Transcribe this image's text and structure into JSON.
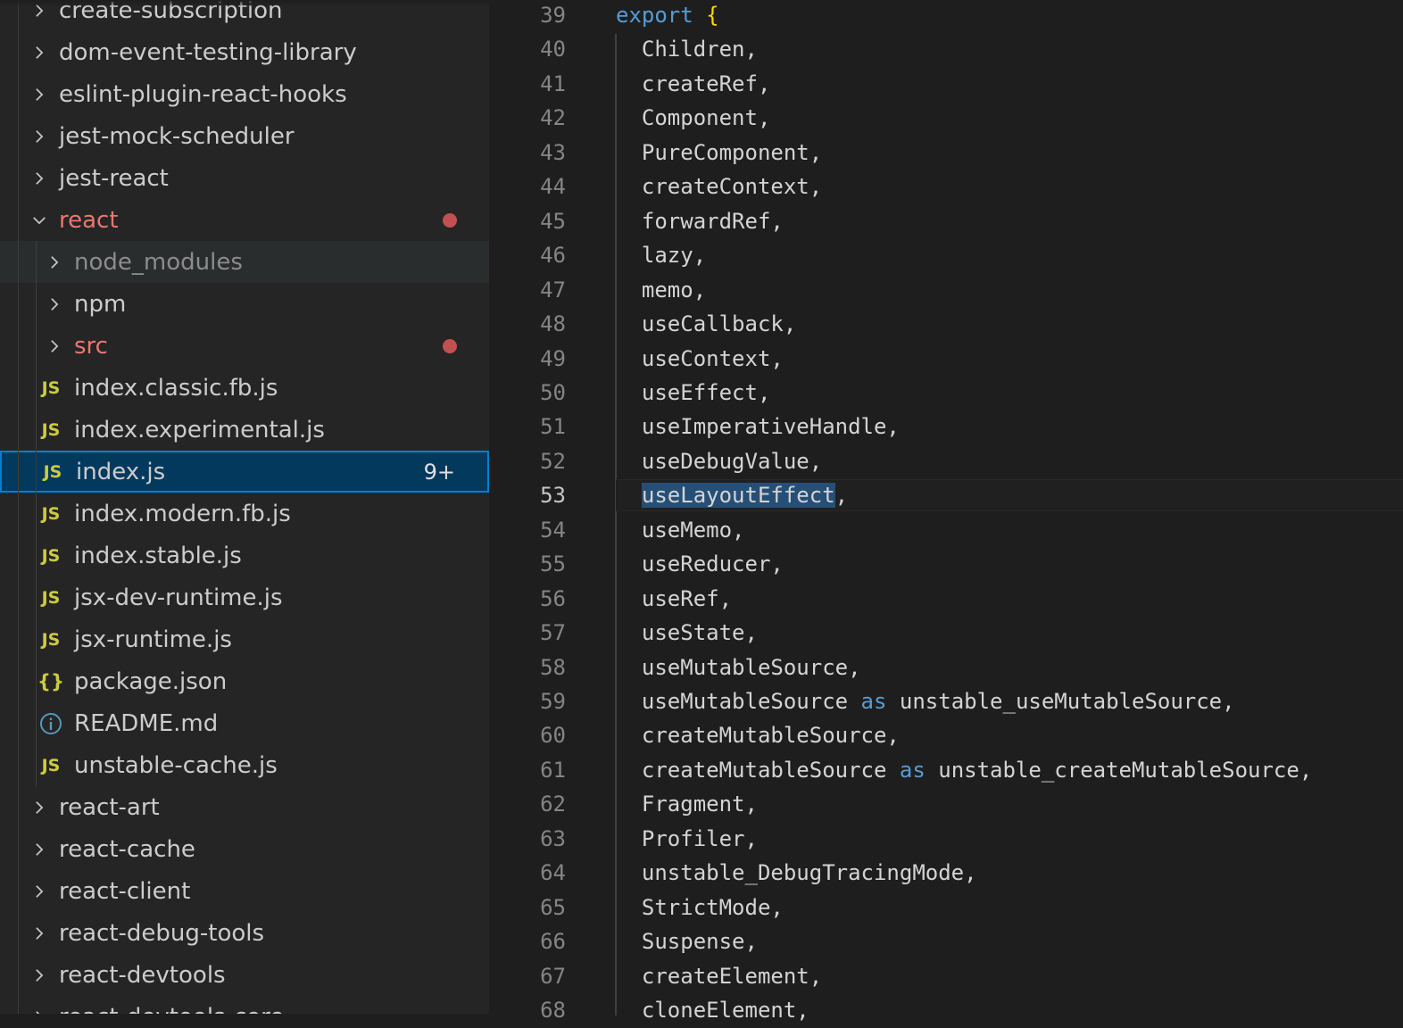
{
  "sidebar": {
    "items": [
      {
        "label": "create-subscription",
        "kind": "folder",
        "expanded": false,
        "depth": 0
      },
      {
        "label": "dom-event-testing-library",
        "kind": "folder",
        "expanded": false,
        "depth": 0
      },
      {
        "label": "eslint-plugin-react-hooks",
        "kind": "folder",
        "expanded": false,
        "depth": 0
      },
      {
        "label": "jest-mock-scheduler",
        "kind": "folder",
        "expanded": false,
        "depth": 0
      },
      {
        "label": "jest-react",
        "kind": "folder",
        "expanded": false,
        "depth": 0
      },
      {
        "label": "react",
        "kind": "folder",
        "expanded": true,
        "depth": 0,
        "modified": true
      },
      {
        "label": "node_modules",
        "kind": "folder",
        "expanded": false,
        "depth": 1,
        "dim": true,
        "hover": true
      },
      {
        "label": "npm",
        "kind": "folder",
        "expanded": false,
        "depth": 1
      },
      {
        "label": "src",
        "kind": "folder",
        "expanded": false,
        "depth": 1,
        "modified": true
      },
      {
        "label": "index.classic.fb.js",
        "kind": "file",
        "icon": "JS",
        "depth": 1
      },
      {
        "label": "index.experimental.js",
        "kind": "file",
        "icon": "JS",
        "depth": 1
      },
      {
        "label": "index.js",
        "kind": "file",
        "icon": "JS",
        "depth": 1,
        "selected": true,
        "badge": "9+"
      },
      {
        "label": "index.modern.fb.js",
        "kind": "file",
        "icon": "JS",
        "depth": 1
      },
      {
        "label": "index.stable.js",
        "kind": "file",
        "icon": "JS",
        "depth": 1
      },
      {
        "label": "jsx-dev-runtime.js",
        "kind": "file",
        "icon": "JS",
        "depth": 1
      },
      {
        "label": "jsx-runtime.js",
        "kind": "file",
        "icon": "JS",
        "depth": 1
      },
      {
        "label": "package.json",
        "kind": "file",
        "icon": "{}",
        "depth": 1
      },
      {
        "label": "README.md",
        "kind": "file",
        "icon": "i",
        "depth": 1
      },
      {
        "label": "unstable-cache.js",
        "kind": "file",
        "icon": "JS",
        "depth": 1
      },
      {
        "label": "react-art",
        "kind": "folder",
        "expanded": false,
        "depth": 0
      },
      {
        "label": "react-cache",
        "kind": "folder",
        "expanded": false,
        "depth": 0
      },
      {
        "label": "react-client",
        "kind": "folder",
        "expanded": false,
        "depth": 0
      },
      {
        "label": "react-debug-tools",
        "kind": "folder",
        "expanded": false,
        "depth": 0
      },
      {
        "label": "react-devtools",
        "kind": "folder",
        "expanded": false,
        "depth": 0
      },
      {
        "label": "react-devtools-core",
        "kind": "folder",
        "expanded": false,
        "depth": 0
      }
    ]
  },
  "editor": {
    "active_line": 53,
    "lines": [
      {
        "n": "39",
        "text": "export {"
      },
      {
        "n": "40",
        "text": "  Children,"
      },
      {
        "n": "41",
        "text": "  createRef,"
      },
      {
        "n": "42",
        "text": "  Component,"
      },
      {
        "n": "43",
        "text": "  PureComponent,"
      },
      {
        "n": "44",
        "text": "  createContext,"
      },
      {
        "n": "45",
        "text": "  forwardRef,"
      },
      {
        "n": "46",
        "text": "  lazy,"
      },
      {
        "n": "47",
        "text": "  memo,"
      },
      {
        "n": "48",
        "text": "  useCallback,"
      },
      {
        "n": "49",
        "text": "  useContext,"
      },
      {
        "n": "50",
        "text": "  useEffect,"
      },
      {
        "n": "51",
        "text": "  useImperativeHandle,"
      },
      {
        "n": "52",
        "text": "  useDebugValue,"
      },
      {
        "n": "53",
        "text": "  useLayoutEffect,"
      },
      {
        "n": "54",
        "text": "  useMemo,"
      },
      {
        "n": "55",
        "text": "  useReducer,"
      },
      {
        "n": "56",
        "text": "  useRef,"
      },
      {
        "n": "57",
        "text": "  useState,"
      },
      {
        "n": "58",
        "text": "  useMutableSource,"
      },
      {
        "n": "59",
        "text": "  useMutableSource as unstable_useMutableSource,"
      },
      {
        "n": "60",
        "text": "  createMutableSource,"
      },
      {
        "n": "61",
        "text": "  createMutableSource as unstable_createMutableSource,"
      },
      {
        "n": "62",
        "text": "  Fragment,"
      },
      {
        "n": "63",
        "text": "  Profiler,"
      },
      {
        "n": "64",
        "text": "  unstable_DebugTracingMode,"
      },
      {
        "n": "65",
        "text": "  StrictMode,"
      },
      {
        "n": "66",
        "text": "  Suspense,"
      },
      {
        "n": "67",
        "text": "  createElement,"
      },
      {
        "n": "68",
        "text": "  cloneElement,"
      }
    ]
  },
  "colors": {
    "sidebar_bg": "#252526",
    "editor_bg": "#1e1e1e",
    "selected_bg": "#04395e",
    "selected_border": "#007fd4",
    "modified": "#e9776f",
    "keyword": "#569cd6",
    "brace": "#ffd700",
    "js_icon": "#cbcb41"
  }
}
